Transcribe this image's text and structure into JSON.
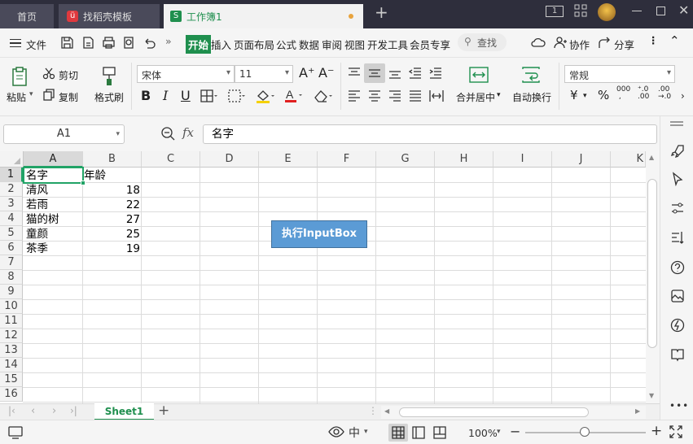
{
  "tabs": {
    "home": "首页",
    "template": "找稻壳模板",
    "workbook": "工作簿1",
    "add": "+"
  },
  "menu": {
    "file": "文件",
    "items": [
      "开始",
      "插入",
      "页面布局",
      "公式",
      "数据",
      "审阅",
      "视图",
      "开发工具",
      "会员专享"
    ],
    "search": "查找",
    "collab": "协作",
    "share": "分享"
  },
  "ribbon": {
    "paste": "粘贴",
    "cut": "剪切",
    "copy": "复制",
    "format_painter": "格式刷",
    "font_name": "宋体",
    "font_size": "11",
    "merge": "合并居中",
    "wrap": "自动换行",
    "number_format": "常规"
  },
  "formula_bar": {
    "name_box": "A1",
    "fx": "fx",
    "content": "名字"
  },
  "grid": {
    "columns": [
      "A",
      "B",
      "C",
      "D",
      "E",
      "F",
      "G",
      "H",
      "I",
      "J",
      "K"
    ],
    "rows": [
      "1",
      "2",
      "3",
      "4",
      "5",
      "6",
      "7",
      "8",
      "9",
      "10",
      "11",
      "12",
      "13",
      "14",
      "15",
      "16"
    ],
    "cells": [
      {
        "a": "名字",
        "b": "年龄"
      },
      {
        "a": "清风",
        "b": "18"
      },
      {
        "a": "若雨",
        "b": "22"
      },
      {
        "a": "猫的树",
        "b": "27"
      },
      {
        "a": "童颜",
        "b": "25"
      },
      {
        "a": "茶季",
        "b": "19"
      }
    ]
  },
  "button": {
    "label": "执行InputBox",
    "color": "#5b9bd5"
  },
  "sheets": {
    "active": "Sheet1"
  },
  "status": {
    "zoom": "100%"
  },
  "colors": {
    "accent": "#1f8f4e",
    "selection": "#21a366",
    "titlebar": "#2e2e3c"
  }
}
